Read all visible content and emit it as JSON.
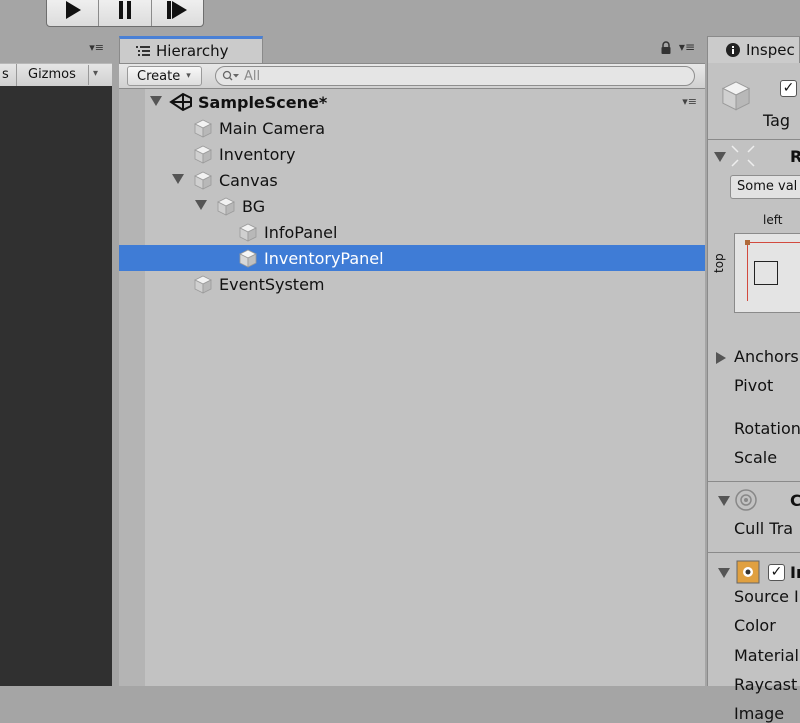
{
  "scene_pane": {
    "menu_glyph": "▾≡",
    "toolbar_partial_label": "s",
    "gizmos_label": "Gizmos",
    "gizmos_arrow": "▾"
  },
  "hierarchy": {
    "tab_label": "Hierarchy",
    "tab_icon": "list-icon",
    "lock_icon": "lock-icon",
    "menu_glyph": "▾≡",
    "create_label": "Create",
    "search_placeholder": "All",
    "scene": {
      "name": "SampleScene*",
      "menu_glyph": "▾≡"
    },
    "items": [
      {
        "name": "Main Camera",
        "depth": 1,
        "expanded": null,
        "selected": false
      },
      {
        "name": "Inventory",
        "depth": 1,
        "expanded": null,
        "selected": false
      },
      {
        "name": "Canvas",
        "depth": 1,
        "expanded": true,
        "selected": false
      },
      {
        "name": "BG",
        "depth": 2,
        "expanded": true,
        "selected": false
      },
      {
        "name": "InfoPanel",
        "depth": 3,
        "expanded": null,
        "selected": false
      },
      {
        "name": "InventoryPanel",
        "depth": 3,
        "expanded": null,
        "selected": true
      },
      {
        "name": "EventSystem",
        "depth": 1,
        "expanded": null,
        "selected": false
      }
    ]
  },
  "inspector": {
    "tab_label": "Inspec",
    "tab_icon": "info-icon",
    "tag_label": "Tag",
    "rect_label": "R",
    "some_values_label": "Some val",
    "left_label": "left",
    "top_label": "top",
    "anchors_label": "Anchors",
    "pivot_label": "Pivot",
    "rotation_label": "Rotation",
    "scale_label": "Scale",
    "canvas_renderer_label": "C",
    "cull_label": "Cull Tra",
    "image_label": "Im",
    "source_label": "Source I",
    "color_label": "Color",
    "material_label": "Material",
    "raycast_label": "Raycast",
    "image_type_label": "Image "
  },
  "colors": {
    "selection": "#3f7cd6",
    "tab_accent": "#4a80d5",
    "scene_view": "#303030"
  }
}
